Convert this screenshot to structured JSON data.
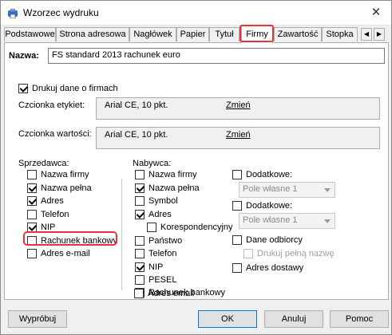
{
  "window": {
    "title": "Wzorzec wydruku"
  },
  "tabs": [
    {
      "label": "Podstawowe"
    },
    {
      "label": "Strona adresowa"
    },
    {
      "label": "Nagłówek"
    },
    {
      "label": "Papier"
    },
    {
      "label": "Tytuł"
    },
    {
      "label": "Firmy"
    },
    {
      "label": "Zawartość"
    },
    {
      "label": "Stopka"
    }
  ],
  "active_tab": "Firmy",
  "name": {
    "label": "Nazwa:",
    "value": "FS standard 2013 rachunek euro"
  },
  "print_company_data": {
    "label": "Drukuj dane o firmach",
    "checked": true
  },
  "label_font": {
    "label": "Czcionka etykiet:",
    "value": "Arial CE, 10 pkt.",
    "change": "Zmień"
  },
  "value_font": {
    "label": "Czcionka wartości:",
    "value": "Arial CE, 10 pkt.",
    "change": "Zmień"
  },
  "seller": {
    "heading": "Sprzedawca:",
    "items": [
      {
        "label": "Nazwa firmy",
        "checked": false
      },
      {
        "label": "Nazwa pełna",
        "checked": true
      },
      {
        "label": "Adres",
        "checked": true
      },
      {
        "label": "Telefon",
        "checked": false
      },
      {
        "label": "NIP",
        "checked": true
      },
      {
        "label": "Rachunek bankowy",
        "checked": false
      },
      {
        "label": "Adres e-mail",
        "checked": false
      }
    ]
  },
  "buyer": {
    "heading": "Nabywca:",
    "items": [
      {
        "label": "Nazwa firmy",
        "checked": false
      },
      {
        "label": "Nazwa pełna",
        "checked": true
      },
      {
        "label": "Symbol",
        "checked": false
      },
      {
        "label": "Adres",
        "checked": true
      },
      {
        "label": "Korespondencyjny",
        "checked": false
      },
      {
        "label": "Państwo",
        "checked": false
      },
      {
        "label": "Telefon",
        "checked": false
      },
      {
        "label": "NIP",
        "checked": true
      },
      {
        "label": "PESEL",
        "checked": false
      },
      {
        "label": "Rachunek bankowy",
        "checked": false
      },
      {
        "label": "Adres email",
        "checked": false
      }
    ]
  },
  "extra": {
    "additional1": {
      "label": "Dodatkowe:",
      "checked": false,
      "select": "Pole własne 1"
    },
    "additional2": {
      "label": "Dodatkowe:",
      "checked": false,
      "select": "Pole własne 1"
    },
    "recipient": {
      "label": "Dane odbiorcy",
      "checked": false
    },
    "print_full_name": {
      "label": "Drukuj pełną nazwę",
      "checked": false
    },
    "delivery_address": {
      "label": "Adres dostawy",
      "checked": false
    }
  },
  "buttons": {
    "try": "Wypróbuj",
    "ok": "OK",
    "cancel": "Anuluj",
    "help": "Pomoc"
  },
  "colors": {
    "highlight": "#e8323c",
    "accent": "#0078d7"
  }
}
